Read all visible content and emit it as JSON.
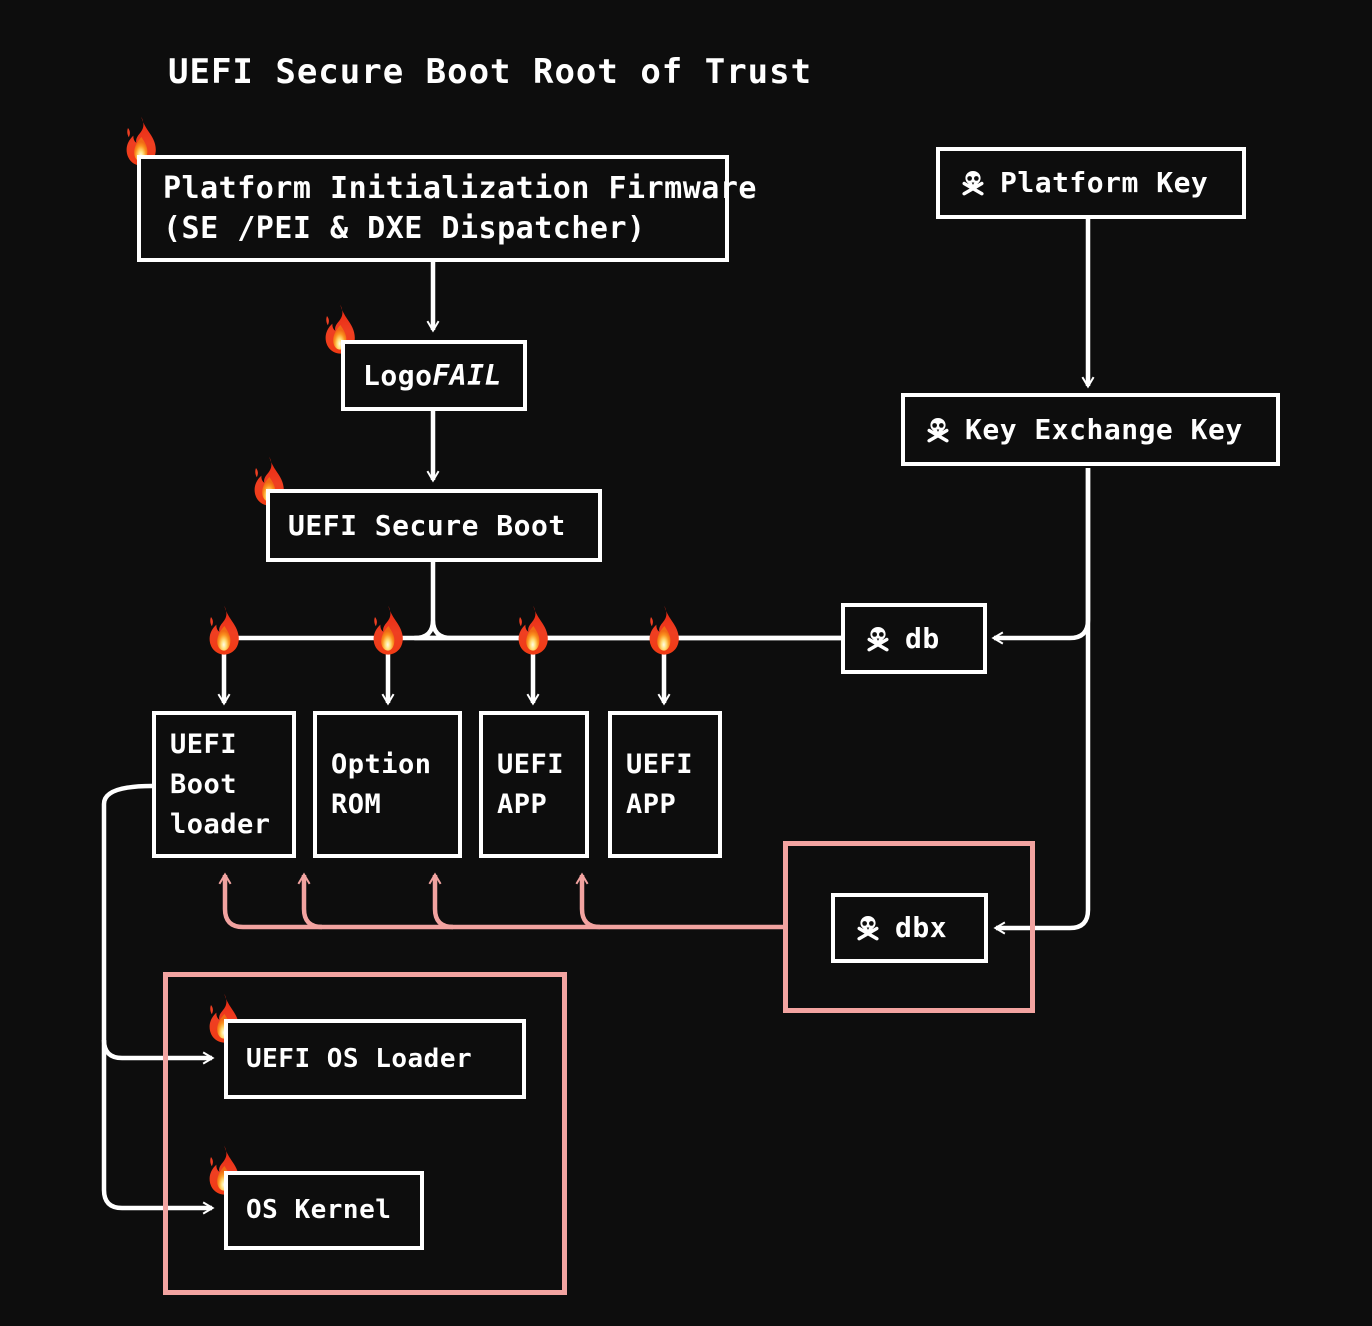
{
  "title": "UEFI Secure Boot Root of Trust",
  "colors": {
    "background": "#0d0d0d",
    "stroke": "#ffffff",
    "revoke_pink": "#f2a3a0",
    "fire_outer": "#ef3f22",
    "fire_mid": "#fb8c20",
    "fire_core": "#ffe08a"
  },
  "nodes": {
    "pi_firmware": {
      "line1": "Platform Initialization Firmware",
      "line2": "(SE /PEI & DXE Dispatcher)"
    },
    "logofail": {
      "prefix": "Logo",
      "emphasis": "FAIL"
    },
    "secure_boot": {
      "label": "UEFI Secure Boot"
    },
    "boot_loader": {
      "line1": "UEFI",
      "line2": "Boot",
      "line3": "loader"
    },
    "option_rom": {
      "line1": "Option",
      "line2": "ROM"
    },
    "uefi_app_1": {
      "line1": "UEFI",
      "line2": "APP"
    },
    "uefi_app_2": {
      "line1": "UEFI",
      "line2": "APP"
    },
    "platform_key": {
      "label": "Platform Key"
    },
    "key_exchange_key": {
      "label": "Key Exchange Key"
    },
    "db": {
      "label": "db"
    },
    "dbx": {
      "label": "dbx"
    },
    "uefi_os_loader": {
      "label": "UEFI OS Loader"
    },
    "os_kernel": {
      "label": "OS Kernel"
    }
  },
  "icons": {
    "fire": "fire-icon",
    "skull": "skull-and-crossbones-icon"
  },
  "groups": {
    "dbx_group": "dbx-revocation-group",
    "os_group": "operating-system-group"
  }
}
